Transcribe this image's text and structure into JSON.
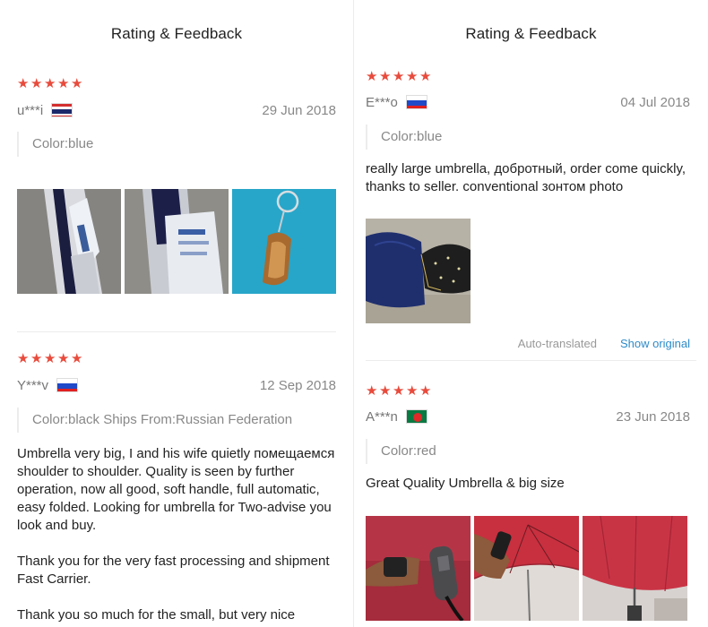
{
  "left": {
    "header": "Rating & Feedback",
    "reviews": [
      {
        "stars": 5,
        "user": "u***i",
        "country": "TH",
        "date": "29 Jun 2018",
        "sku": "Color:blue",
        "photos": [
          "umbrella-in-package-photo",
          "umbrella-package-dark-photo",
          "keychain-photo"
        ]
      },
      {
        "stars": 5,
        "user": "Y***v",
        "country": "RU",
        "date": "12 Sep 2018",
        "sku": "Color:black Ships From:Russian Federation",
        "text": [
          "Umbrella very big, I and his wife quietly помещаемся shoulder to shoulder. Quality is seen by further operation, now all good, soft handle, full automatic, easy folded. Looking for umbrella for Two-advise you look and buy.",
          "Thank you for the very fast processing and shipment Fast Carrier.",
          "Thank you so much for the small, but very nice souvenir."
        ]
      }
    ]
  },
  "right": {
    "header": "Rating & Feedback",
    "reviews": [
      {
        "stars": 5,
        "user": "E***o",
        "country": "RU",
        "date": "04 Jul 2018",
        "sku": "Color:blue",
        "text": "really large umbrella, добротный, order come quickly, thanks to seller. conventional зонтом photo",
        "photos": [
          "open-umbrellas-photo"
        ],
        "auto_translated": "Auto-translated",
        "show_original": "Show original"
      },
      {
        "stars": 5,
        "user": "A***n",
        "country": "BD",
        "date": "23 Jun 2018",
        "sku": "Color:red",
        "text": "Great Quality Umbrella & big size",
        "photos": [
          "hand-holding-umbrella-photo",
          "red-umbrella-arm-photo",
          "red-umbrella-open-photo"
        ]
      }
    ]
  },
  "colors": {
    "star": "#e84b3c",
    "link": "#2e8bc9",
    "muted": "#888888"
  }
}
